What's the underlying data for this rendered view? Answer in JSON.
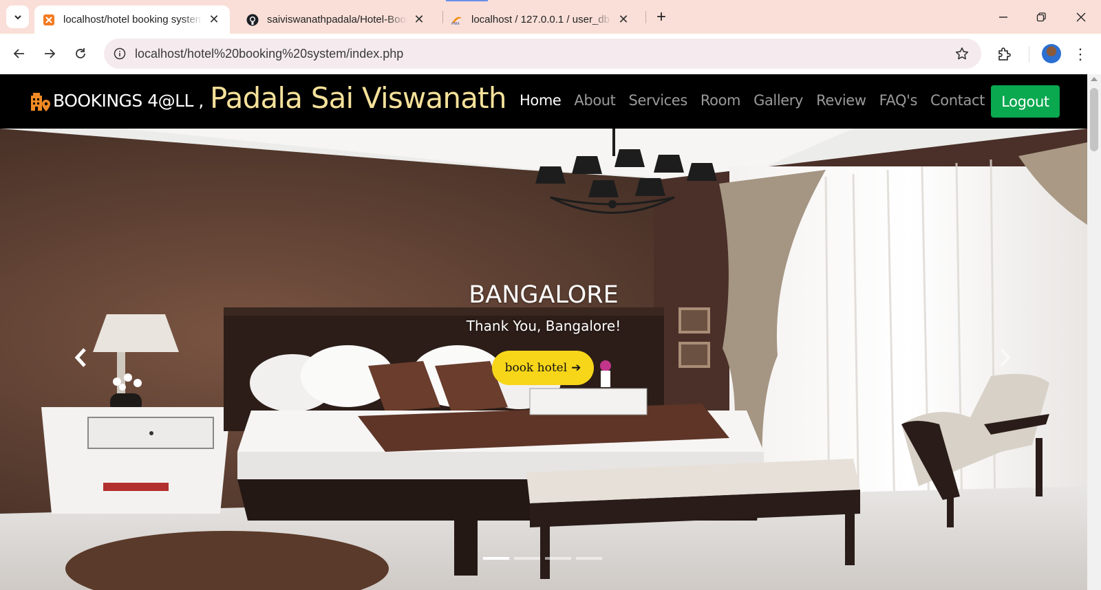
{
  "browser": {
    "tabs": [
      {
        "title": "localhost/hotel booking system",
        "favicon": "xampp-icon",
        "active": true
      },
      {
        "title": "saiviswanathpadala/Hotel-Book",
        "favicon": "github-icon",
        "active": false
      },
      {
        "title": "localhost / 127.0.0.1 / user_db /",
        "favicon": "phpmyadmin-icon",
        "active": false
      }
    ],
    "new_tab_glyph": "+",
    "close_glyph": "✕",
    "address": "localhost/hotel%20booking%20system/index.php",
    "menu_glyph": "⋮"
  },
  "site": {
    "brand": "BOOKINGS 4@LL ,",
    "user_name": "Padala Sai Viswanath",
    "nav": [
      {
        "label": "Home",
        "current": true
      },
      {
        "label": "About",
        "current": false
      },
      {
        "label": "Services",
        "current": false
      },
      {
        "label": "Room",
        "current": false
      },
      {
        "label": "Gallery",
        "current": false
      },
      {
        "label": "Review",
        "current": false
      },
      {
        "label": "FAQ's",
        "current": false
      },
      {
        "label": "Contact",
        "current": false
      }
    ],
    "logout_label": "Logout",
    "colors": {
      "navbar": "#000000",
      "user_name": "#f5e19a",
      "logout": "#0aa84f",
      "book_button": "#f7d61a"
    }
  },
  "carousel": {
    "title": "BANGALORE",
    "subtitle": "Thank You, Bangalore!",
    "button_label": "book hotel",
    "button_arrow": "➔",
    "slide_count": 4,
    "active_slide": 1
  }
}
